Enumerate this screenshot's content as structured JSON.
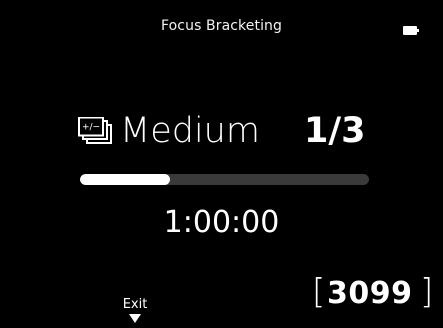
{
  "header": {
    "title": "Focus Bracketing",
    "battery_icon": "battery-full-icon"
  },
  "mode": {
    "icon": "focus-bracketing-icon",
    "icon_text": "+/−",
    "label": "Medium",
    "counter": "1/3"
  },
  "progress": {
    "fraction": 0.31
  },
  "timer": {
    "value": "1:00:00"
  },
  "footer": {
    "exit_label": "Exit",
    "exit_icon": "down-arrow-icon",
    "shots_remaining": "3099",
    "bracket_left": "[",
    "bracket_right": "]"
  },
  "colors": {
    "background": "#000000",
    "foreground": "#ffffff",
    "track": "#3a3a3a"
  }
}
